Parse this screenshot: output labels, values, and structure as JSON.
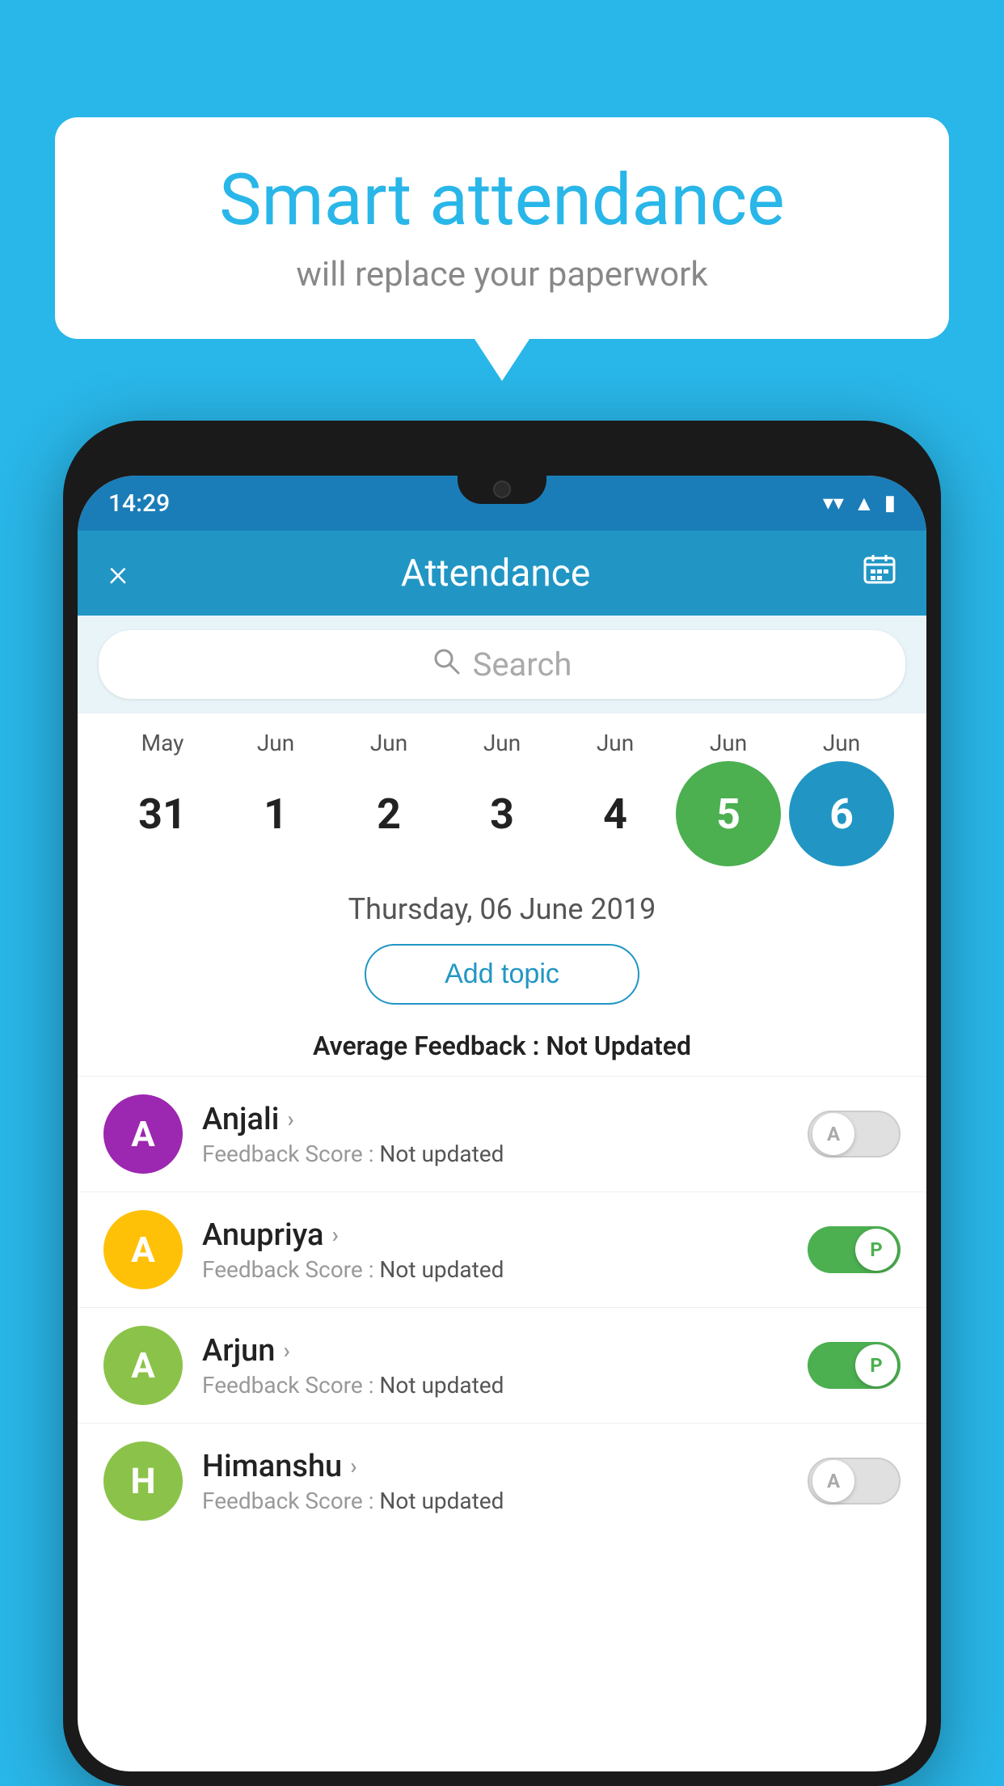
{
  "background_color": "#29b6e8",
  "bubble": {
    "title": "Smart attendance",
    "subtitle": "will replace your paperwork"
  },
  "phone": {
    "status_bar": {
      "time": "14:29",
      "icons": [
        "wifi",
        "signal",
        "battery"
      ]
    },
    "header": {
      "title": "Attendance",
      "close_label": "×",
      "calendar_icon": "📅"
    },
    "search": {
      "placeholder": "Search"
    },
    "calendar": {
      "months": [
        "May",
        "Jun",
        "Jun",
        "Jun",
        "Jun",
        "Jun",
        "Jun"
      ],
      "days": [
        "31",
        "1",
        "2",
        "3",
        "4",
        "5",
        "6"
      ],
      "active_green_index": 5,
      "active_blue_index": 6
    },
    "selected_date": "Thursday, 06 June 2019",
    "add_topic_label": "Add topic",
    "avg_feedback_prefix": "Average Feedback : ",
    "avg_feedback_value": "Not Updated",
    "students": [
      {
        "name": "Anjali",
        "initial": "A",
        "avatar_color": "#9c27b0",
        "feedback": "Not updated",
        "toggle_state": "off",
        "toggle_label": "A"
      },
      {
        "name": "Anupriya",
        "initial": "A",
        "avatar_color": "#ffc107",
        "feedback": "Not updated",
        "toggle_state": "on",
        "toggle_label": "P"
      },
      {
        "name": "Arjun",
        "initial": "A",
        "avatar_color": "#8bc34a",
        "feedback": "Not updated",
        "toggle_state": "on",
        "toggle_label": "P"
      },
      {
        "name": "Himanshu",
        "initial": "H",
        "avatar_color": "#8bc34a",
        "feedback": "Not updated",
        "toggle_state": "off",
        "toggle_label": "A"
      }
    ]
  }
}
